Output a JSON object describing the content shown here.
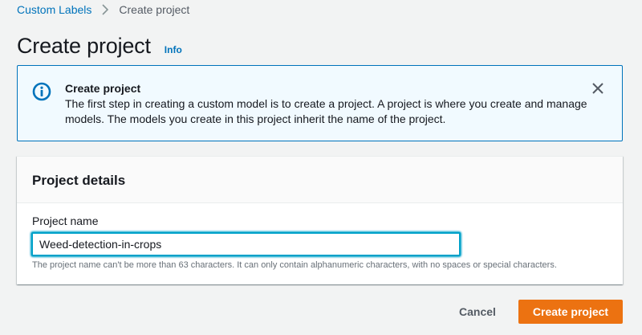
{
  "breadcrumb": {
    "items": [
      {
        "label": "Custom Labels"
      },
      {
        "label": "Create project"
      }
    ]
  },
  "header": {
    "title": "Create project",
    "info_label": "Info"
  },
  "flash": {
    "title": "Create project",
    "body": "The first step in creating a custom model is to create a project. A project is where you create and manage models. The models you create in this project inherit the name of the project.",
    "icon": "info-icon",
    "close_icon": "close-icon"
  },
  "project_details": {
    "title": "Project details",
    "name_label": "Project name",
    "name_value": "Weed-detection-in-crops",
    "constraint": "The project name can't be more than 63 characters. It can only contain alphanumeric characters, with no spaces or special characters."
  },
  "actions": {
    "cancel_label": "Cancel",
    "submit_label": "Create project"
  },
  "colors": {
    "link": "#0073bb",
    "primary_button": "#ec7211",
    "info_background": "#f1faff",
    "focus_ring": "#00a1c9"
  }
}
